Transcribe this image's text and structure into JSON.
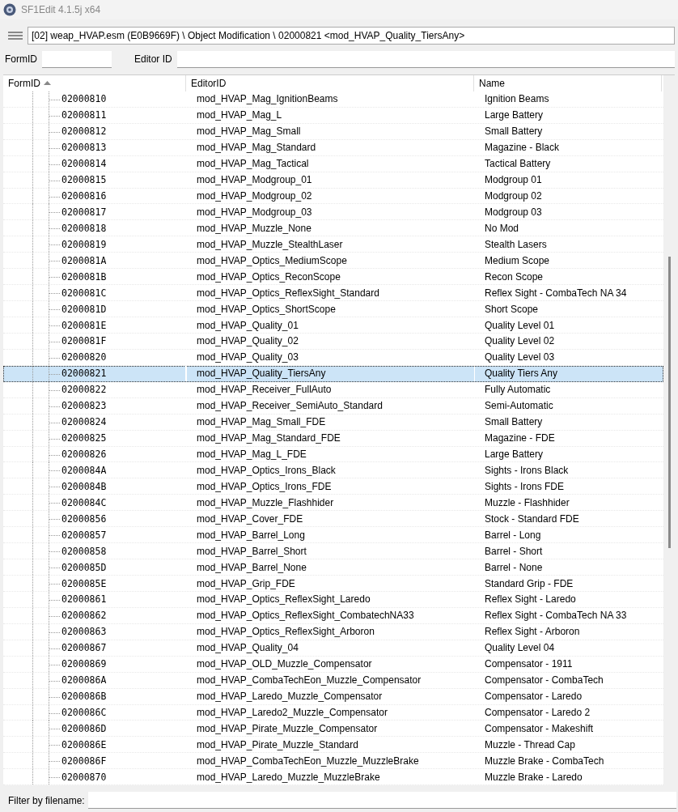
{
  "window": {
    "title": "SF1Edit 4.1.5j x64"
  },
  "path": {
    "value": "[02] weap_HVAP.esm (E0B9669F) \\ Object Modification \\ 02000821 <mod_HVAP_Quality_TiersAny>"
  },
  "filters": [
    {
      "label": "FormID"
    },
    {
      "label": "Editor ID"
    }
  ],
  "table": {
    "columns": [
      {
        "label": "FormID",
        "sorted": true
      },
      {
        "label": "EditorID",
        "sorted": false
      },
      {
        "label": "Name",
        "sorted": false
      }
    ],
    "rows": [
      {
        "form_id": "02000810",
        "editor_id": "mod_HVAP_Mag_IgnitionBeams",
        "name": "Ignition Beams",
        "selected": false
      },
      {
        "form_id": "02000811",
        "editor_id": "mod_HVAP_Mag_L",
        "name": "Large Battery",
        "selected": false
      },
      {
        "form_id": "02000812",
        "editor_id": "mod_HVAP_Mag_Small",
        "name": "Small Battery",
        "selected": false
      },
      {
        "form_id": "02000813",
        "editor_id": "mod_HVAP_Mag_Standard",
        "name": "Magazine - Black",
        "selected": false
      },
      {
        "form_id": "02000814",
        "editor_id": "mod_HVAP_Mag_Tactical",
        "name": "Tactical Battery",
        "selected": false
      },
      {
        "form_id": "02000815",
        "editor_id": "mod_HVAP_Modgroup_01",
        "name": "Modgroup 01",
        "selected": false
      },
      {
        "form_id": "02000816",
        "editor_id": "mod_HVAP_Modgroup_02",
        "name": "Modgroup 02",
        "selected": false
      },
      {
        "form_id": "02000817",
        "editor_id": "mod_HVAP_Modgroup_03",
        "name": "Modgroup 03",
        "selected": false
      },
      {
        "form_id": "02000818",
        "editor_id": "mod_HVAP_Muzzle_None",
        "name": "No Mod",
        "selected": false
      },
      {
        "form_id": "02000819",
        "editor_id": "mod_HVAP_Muzzle_StealthLaser",
        "name": "Stealth Lasers",
        "selected": false
      },
      {
        "form_id": "0200081A",
        "editor_id": "mod_HVAP_Optics_MediumScope",
        "name": "Medium Scope",
        "selected": false
      },
      {
        "form_id": "0200081B",
        "editor_id": "mod_HVAP_Optics_ReconScope",
        "name": "Recon Scope",
        "selected": false
      },
      {
        "form_id": "0200081C",
        "editor_id": "mod_HVAP_Optics_ReflexSight_Standard",
        "name": "Reflex Sight - CombaTech NA 34",
        "selected": false
      },
      {
        "form_id": "0200081D",
        "editor_id": "mod_HVAP_Optics_ShortScope",
        "name": "Short Scope",
        "selected": false
      },
      {
        "form_id": "0200081E",
        "editor_id": "mod_HVAP_Quality_01",
        "name": "Quality Level 01",
        "selected": false
      },
      {
        "form_id": "0200081F",
        "editor_id": "mod_HVAP_Quality_02",
        "name": "Quality Level 02",
        "selected": false
      },
      {
        "form_id": "02000820",
        "editor_id": "mod_HVAP_Quality_03",
        "name": "Quality Level 03",
        "selected": false
      },
      {
        "form_id": "02000821",
        "editor_id": "mod_HVAP_Quality_TiersAny",
        "name": "Quality Tiers Any",
        "selected": true
      },
      {
        "form_id": "02000822",
        "editor_id": "mod_HVAP_Receiver_FullAuto",
        "name": "Fully Automatic",
        "selected": false
      },
      {
        "form_id": "02000823",
        "editor_id": "mod_HVAP_Receiver_SemiAuto_Standard",
        "name": "Semi-Automatic",
        "selected": false
      },
      {
        "form_id": "02000824",
        "editor_id": "mod_HVAP_Mag_Small_FDE",
        "name": "Small Battery",
        "selected": false
      },
      {
        "form_id": "02000825",
        "editor_id": "mod_HVAP_Mag_Standard_FDE",
        "name": "Magazine - FDE",
        "selected": false
      },
      {
        "form_id": "02000826",
        "editor_id": "mod_HVAP_Mag_L_FDE",
        "name": "Large Battery",
        "selected": false
      },
      {
        "form_id": "0200084A",
        "editor_id": "mod_HVAP_Optics_Irons_Black",
        "name": "Sights - Irons Black",
        "selected": false
      },
      {
        "form_id": "0200084B",
        "editor_id": "mod_HVAP_Optics_Irons_FDE",
        "name": "Sights - Irons FDE",
        "selected": false
      },
      {
        "form_id": "0200084C",
        "editor_id": "mod_HVAP_Muzzle_Flashhider",
        "name": "Muzzle - Flashhider",
        "selected": false
      },
      {
        "form_id": "02000856",
        "editor_id": "mod_HVAP_Cover_FDE",
        "name": "Stock - Standard FDE",
        "selected": false
      },
      {
        "form_id": "02000857",
        "editor_id": "mod_HVAP_Barrel_Long",
        "name": "Barrel - Long",
        "selected": false
      },
      {
        "form_id": "02000858",
        "editor_id": "mod_HVAP_Barrel_Short",
        "name": "Barrel - Short",
        "selected": false
      },
      {
        "form_id": "0200085D",
        "editor_id": "mod_HVAP_Barrel_None",
        "name": "Barrel - None",
        "selected": false
      },
      {
        "form_id": "0200085E",
        "editor_id": "mod_HVAP_Grip_FDE",
        "name": "Standard Grip - FDE",
        "selected": false
      },
      {
        "form_id": "02000861",
        "editor_id": "mod_HVAP_Optics_ReflexSight_Laredo",
        "name": "Reflex Sight - Laredo",
        "selected": false
      },
      {
        "form_id": "02000862",
        "editor_id": "mod_HVAP_Optics_ReflexSight_CombatechNA33",
        "name": "Reflex Sight - CombaTech NA 33",
        "selected": false
      },
      {
        "form_id": "02000863",
        "editor_id": "mod_HVAP_Optics_ReflexSight_Arboron",
        "name": "Reflex Sight - Arboron",
        "selected": false
      },
      {
        "form_id": "02000867",
        "editor_id": "mod_HVAP_Quality_04",
        "name": "Quality Level 04",
        "selected": false
      },
      {
        "form_id": "02000869",
        "editor_id": "mod_HVAP_OLD_Muzzle_Compensator",
        "name": "Compensator - 1911",
        "selected": false
      },
      {
        "form_id": "0200086A",
        "editor_id": "mod_HVAP_CombaTechEon_Muzzle_Compensator",
        "name": "Compensator - CombaTech",
        "selected": false
      },
      {
        "form_id": "0200086B",
        "editor_id": "mod_HVAP_Laredo_Muzzle_Compensator",
        "name": "Compensator - Laredo",
        "selected": false
      },
      {
        "form_id": "0200086C",
        "editor_id": "mod_HVAP_Laredo2_Muzzle_Compensator",
        "name": "Compensator - Laredo 2",
        "selected": false
      },
      {
        "form_id": "0200086D",
        "editor_id": "mod_HVAP_Pirate_Muzzle_Compensator",
        "name": "Compensator - Makeshift",
        "selected": false
      },
      {
        "form_id": "0200086E",
        "editor_id": "mod_HVAP_Pirate_Muzzle_Standard",
        "name": "Muzzle - Thread Cap",
        "selected": false
      },
      {
        "form_id": "0200086F",
        "editor_id": "mod_HVAP_CombaTechEon_Muzzle_MuzzleBrake",
        "name": "Muzzle Brake - CombaTech",
        "selected": false
      },
      {
        "form_id": "02000870",
        "editor_id": "mod_HVAP_Laredo_Muzzle_MuzzleBrake",
        "name": "Muzzle Brake - Laredo",
        "selected": false
      }
    ]
  },
  "file_filter": {
    "label": "Filter by filename:"
  }
}
